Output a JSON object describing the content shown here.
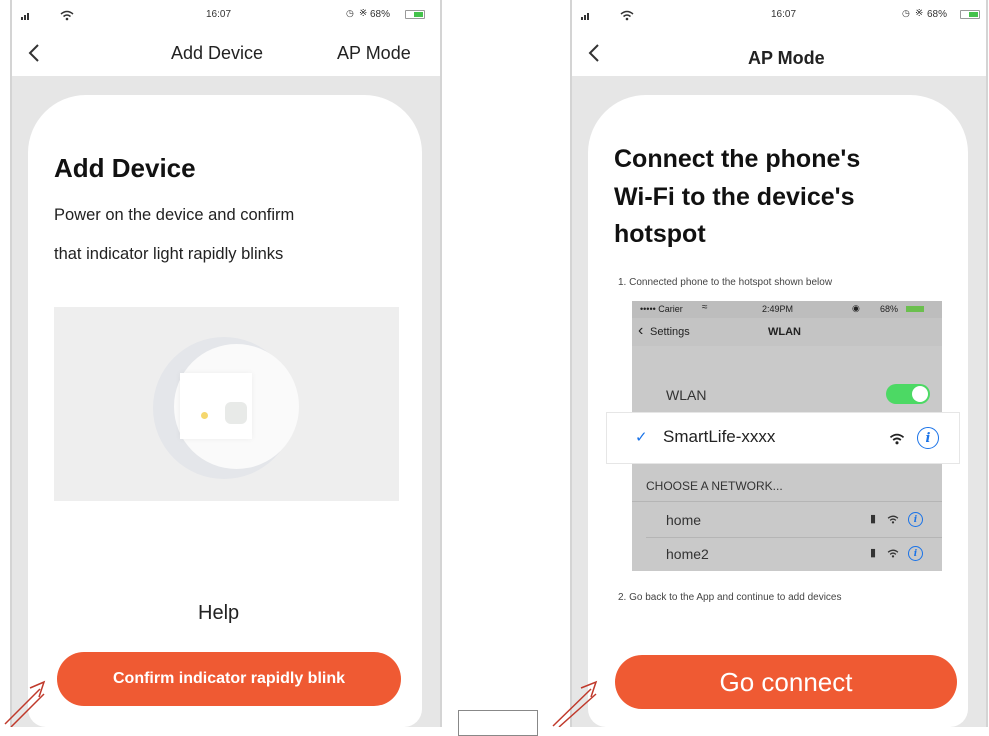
{
  "left_screen": {
    "status": {
      "time": "16:07",
      "battery": "68%"
    },
    "nav": {
      "title": "Add Device",
      "right": "AP Mode",
      "back_icon": "chevron-left-icon"
    },
    "card": {
      "title": "Add Device",
      "line1": "Power on the device and confirm",
      "line2": "that indicator light rapidly blinks"
    },
    "help_label": "Help",
    "confirm_button": "Confirm indicator rapidly blink"
  },
  "right_screen": {
    "status": {
      "time": "16:07",
      "battery": "68%"
    },
    "nav": {
      "title": "AP Mode",
      "back_icon": "chevron-left-icon"
    },
    "card": {
      "title_line1": "Connect the phone's",
      "title_line2": "Wi-Fi to the device's",
      "title_line3": "hotspot",
      "step1": "1. Connected phone to the hotspot shown below",
      "step2": "2. Go back to the App and continue to add devices"
    },
    "inner_phone": {
      "carrier": "••••• Carier",
      "time": "2:49PM",
      "battery": "68%",
      "back_label": "Settings",
      "title": "WLAN",
      "wlan_label": "WLAN",
      "selected_network": "SmartLife-xxxx",
      "choose_header": "CHOOSE A NETWORK...",
      "networks": [
        "home",
        "home2"
      ]
    },
    "go_button": "Go connect"
  },
  "colors": {
    "accent": "#ef5a33",
    "toggle_on": "#4cd964",
    "info_blue": "#1a73e8",
    "arrow": "#c0392b"
  }
}
